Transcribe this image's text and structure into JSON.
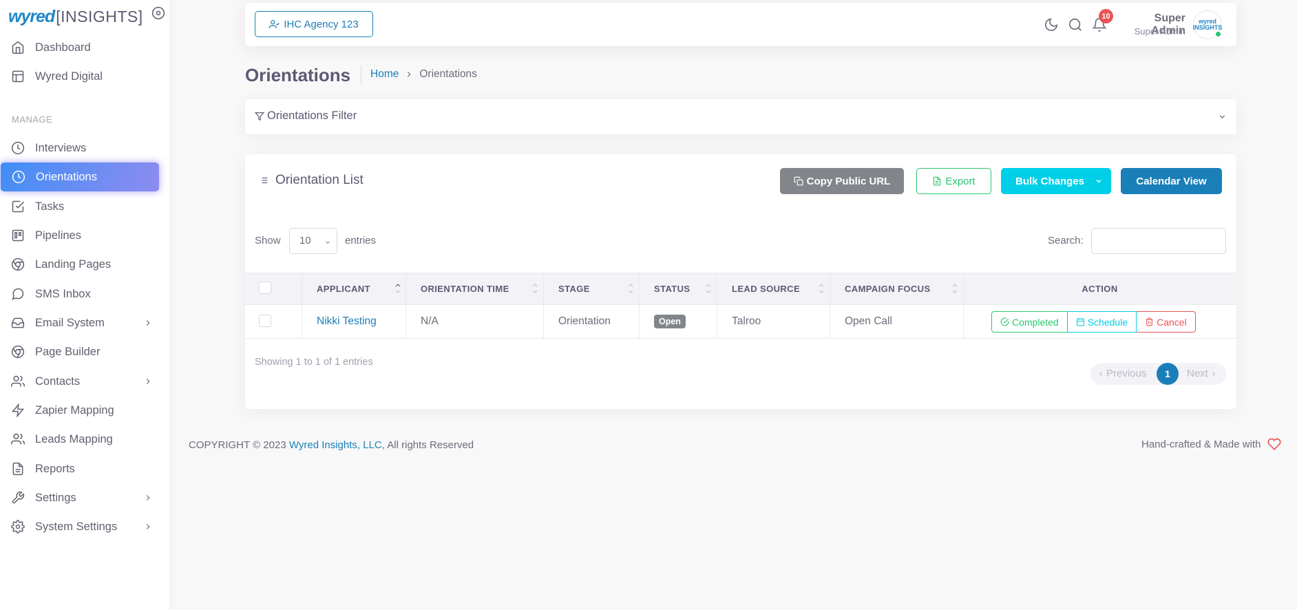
{
  "brand": {
    "name_part1": "wyred",
    "name_part2": "[INSIGHTS]"
  },
  "sidebar": {
    "manage_header": "MANAGE",
    "items": [
      {
        "label": "Dashboard",
        "icon": "home-icon"
      },
      {
        "label": "Wyred Digital",
        "icon": "layout-icon"
      },
      {
        "label": "Interviews",
        "icon": "clock-icon"
      },
      {
        "label": "Orientations",
        "icon": "clock-icon",
        "active": true
      },
      {
        "label": "Tasks",
        "icon": "check-square-icon"
      },
      {
        "label": "Pipelines",
        "icon": "trello-icon"
      },
      {
        "label": "Landing Pages",
        "icon": "chrome-icon"
      },
      {
        "label": "SMS Inbox",
        "icon": "message-circle-icon"
      },
      {
        "label": "Email System",
        "icon": "inbox-icon",
        "has_submenu": true
      },
      {
        "label": "Page Builder",
        "icon": "chrome-icon"
      },
      {
        "label": "Contacts",
        "icon": "users-icon",
        "has_submenu": true
      },
      {
        "label": "Zapier Mapping",
        "icon": "zap-icon"
      },
      {
        "label": "Leads Mapping",
        "icon": "users-icon"
      },
      {
        "label": "Reports",
        "icon": "file-text-icon"
      },
      {
        "label": "Settings",
        "icon": "tool-icon",
        "has_submenu": true
      },
      {
        "label": "System Settings",
        "icon": "settings-icon",
        "has_submenu": true
      }
    ]
  },
  "navbar": {
    "agency_label": "IHC Agency 123",
    "notification_count": "10",
    "user_name": "Super Admin",
    "user_role": "Super Admin",
    "avatar_text": "wyred INSIGHTS"
  },
  "page": {
    "title": "Orientations",
    "breadcrumb_home": "Home",
    "breadcrumb_current": "Orientations"
  },
  "filter": {
    "title": "Orientations Filter"
  },
  "list": {
    "title": "Orientation List",
    "btn_copy": "Copy Public URL",
    "btn_export": "Export",
    "btn_bulk": "Bulk Changes",
    "btn_calendar": "Calendar View",
    "show_label": "Show",
    "show_value": "10",
    "entries_label": "entries",
    "search_label": "Search:",
    "columns": [
      "APPLICANT",
      "ORIENTATION TIME",
      "STAGE",
      "STATUS",
      "LEAD SOURCE",
      "CAMPAIGN FOCUS",
      "ACTION"
    ],
    "rows": [
      {
        "applicant": "Nikki Testing",
        "orientation_time": "N/A",
        "stage": "Orientation",
        "status": "Open",
        "lead_source": "Talroo",
        "campaign_focus": "Open Call",
        "actions": {
          "completed": "Completed",
          "schedule": "Schedule",
          "cancel": "Cancel"
        }
      }
    ],
    "showing_text": "Showing 1 to 1 of 1 entries",
    "pager": {
      "prev": "Previous",
      "current_page": "1",
      "next": "Next"
    }
  },
  "footer": {
    "copyright": "COPYRIGHT © 2023",
    "company": "Wyred Insights, LLC",
    "rights": ", All rights Reserved",
    "made_with": "Hand-crafted & Made with"
  },
  "colors": {
    "primary": "#1a7fb8",
    "active_gradient_start": "#3f8ef6",
    "success": "#28c76f",
    "info": "#00cfe8",
    "danger": "#ea5455",
    "secondary": "#82868b"
  }
}
